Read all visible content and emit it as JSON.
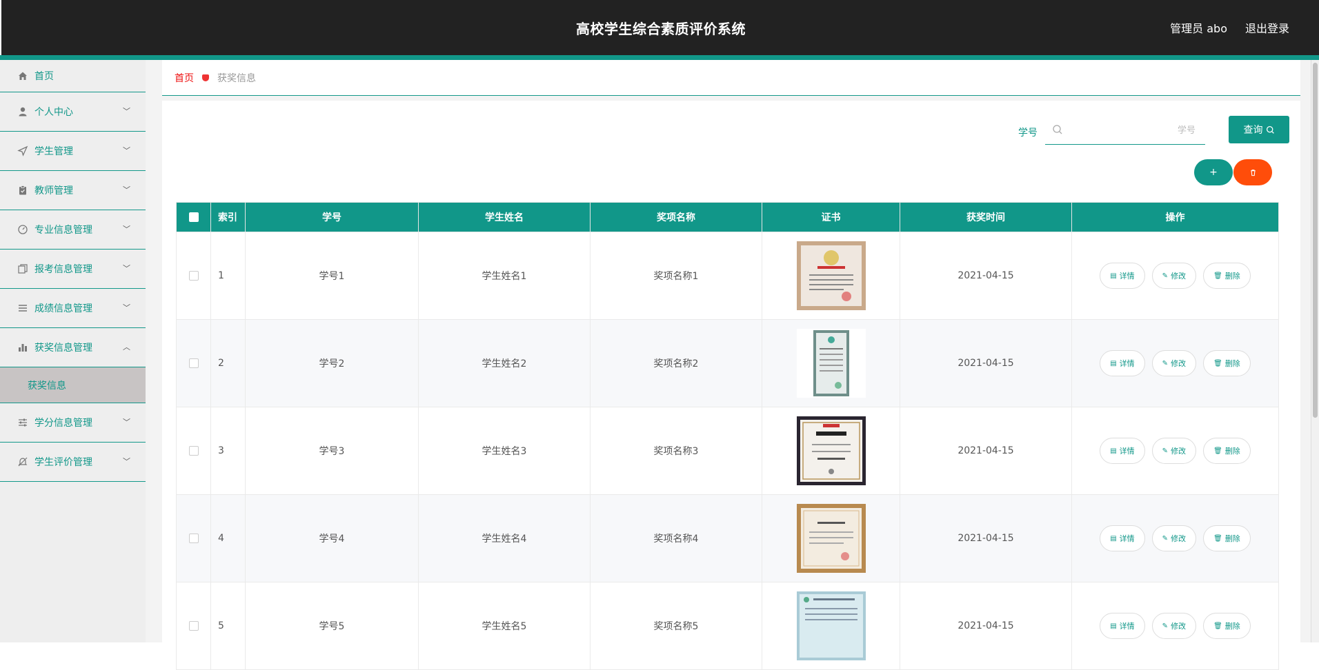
{
  "header": {
    "title": "高校学生综合素质评价系统",
    "user": "管理员 abo",
    "logout": "退出登录"
  },
  "sidebar": {
    "items": [
      {
        "label": "首页",
        "icon": "home-icon"
      },
      {
        "label": "个人中心",
        "icon": "user-icon"
      },
      {
        "label": "学生管理",
        "icon": "send-icon"
      },
      {
        "label": "教师管理",
        "icon": "clipboard-icon"
      },
      {
        "label": "专业信息管理",
        "icon": "gauge-icon"
      },
      {
        "label": "报考信息管理",
        "icon": "copy-icon"
      },
      {
        "label": "成绩信息管理",
        "icon": "list-icon"
      },
      {
        "label": "获奖信息管理",
        "icon": "bar-chart-icon"
      },
      {
        "label": "学分信息管理",
        "icon": "sliders-icon"
      },
      {
        "label": "学生评价管理",
        "icon": "bell-off-icon"
      }
    ],
    "active_sub": "获奖信息"
  },
  "breadcrumb": {
    "home": "首页",
    "current": "获奖信息"
  },
  "search": {
    "label": "学号",
    "placeholder": "学号",
    "button": "查询"
  },
  "actions": {
    "add": "+",
    "delete": "🗑"
  },
  "table": {
    "headers": [
      "索引",
      "学号",
      "学生姓名",
      "奖项名称",
      "证书",
      "获奖时间",
      "操作"
    ],
    "rows": [
      {
        "index": "1",
        "student_no": "学号1",
        "name": "学生姓名1",
        "award": "奖项名称1",
        "date": "2021-04-15"
      },
      {
        "index": "2",
        "student_no": "学号2",
        "name": "学生姓名2",
        "award": "奖项名称2",
        "date": "2021-04-15"
      },
      {
        "index": "3",
        "student_no": "学号3",
        "name": "学生姓名3",
        "award": "奖项名称3",
        "date": "2021-04-15"
      },
      {
        "index": "4",
        "student_no": "学号4",
        "name": "学生姓名4",
        "award": "奖项名称4",
        "date": "2021-04-15"
      },
      {
        "index": "5",
        "student_no": "学号5",
        "name": "学生姓名5",
        "award": "奖项名称5",
        "date": "2021-04-15"
      }
    ],
    "row_actions": {
      "detail": "详情",
      "edit": "修改",
      "delete": "删除"
    }
  },
  "colors": {
    "primary": "#119789",
    "danger": "#ff4d0a",
    "topbar": "#222222"
  }
}
